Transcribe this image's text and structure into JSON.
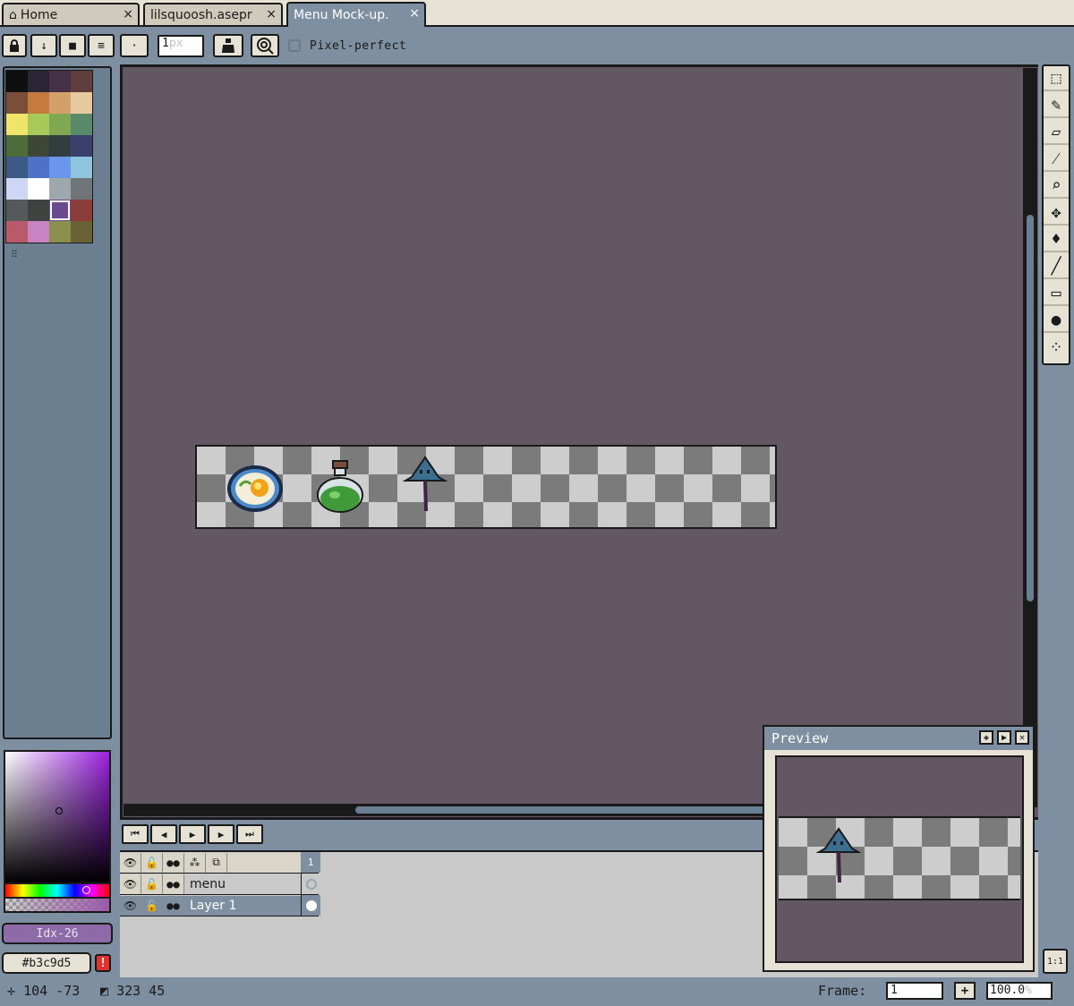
{
  "tabs": [
    {
      "label": "Home",
      "icon": "home-icon",
      "close": "×"
    },
    {
      "label": "lilsquoosh.asepr",
      "close": "×"
    },
    {
      "label": "Menu Mock-up.",
      "close": "×",
      "active": true
    }
  ],
  "context_bar": {
    "brush_size": "1",
    "brush_unit": "px",
    "pixel_perfect_label": "Pixel-perfect",
    "pixel_perfect_checked": false
  },
  "palette": {
    "swatches": [
      "#0f0f0f",
      "#2a2535",
      "#463247",
      "#5e3f3d",
      "#7b4e39",
      "#c57a3e",
      "#d3a06a",
      "#e7c9a0",
      "#f1e46b",
      "#a6c95a",
      "#7fa851",
      "#5a8a6a",
      "#4e6b3a",
      "#3e4635",
      "#323d3f",
      "#3b3f6b",
      "#3d5a86",
      "#4f72c9",
      "#6a97eb",
      "#8fc5df",
      "#cdd6f5",
      "#ffffff",
      "#9ea6ae",
      "#6f7579",
      "#56595b",
      "#3f4340",
      "#6b4a8f",
      "#8a3d3b",
      "#b85a6a",
      "#c883c3",
      "#8a8f4d",
      "#6a6234"
    ],
    "grip": "⠿"
  },
  "color": {
    "fg_label": "Idx-26",
    "bg_label": "#b3c9d5",
    "warning": "!",
    "picker_hue": "#9b20e0"
  },
  "tools": [
    "marquee-tool",
    "pencil-tool",
    "eraser-tool",
    "eyedropper-tool",
    "zoom-tool",
    "move-tool",
    "fill-tool",
    "line-tool",
    "rectangle-tool",
    "blur-tool",
    "spray-tool"
  ],
  "timeline": {
    "frame_header": "1",
    "layers": [
      {
        "name": "menu",
        "selected": false
      },
      {
        "name": "Layer 1",
        "selected": true
      }
    ]
  },
  "preview": {
    "title": "Preview"
  },
  "status": {
    "cursor": "104 -73",
    "selection": "323 45",
    "frame_label": "Frame:",
    "frame_value": "1",
    "zoom": "100.0",
    "zoom_unit": "%",
    "one_to_one": "1:1"
  }
}
